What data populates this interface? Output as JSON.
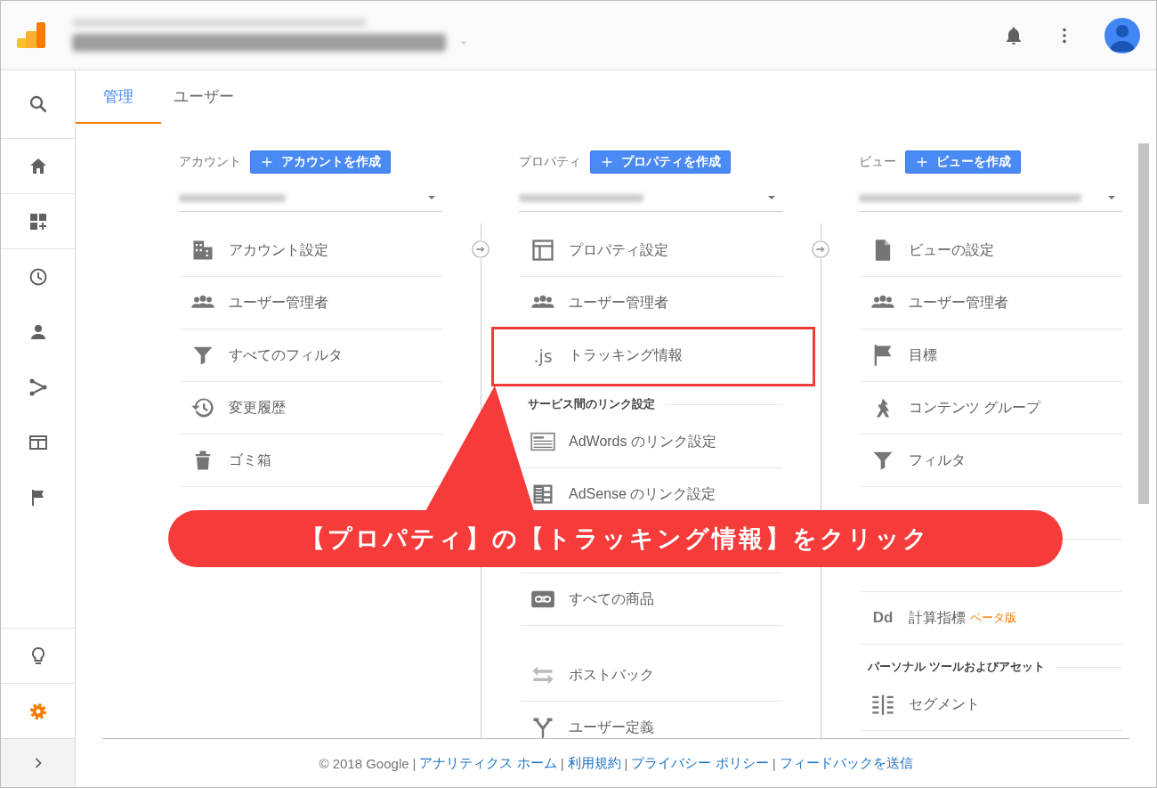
{
  "nav": {
    "items": [
      {
        "selected": false
      },
      {
        "selected": false
      },
      {
        "selected": false
      },
      {
        "selected": false
      },
      {
        "selected": false
      },
      {
        "selected": false
      },
      {
        "selected": false
      },
      {
        "selected": false
      }
    ],
    "bottom": [
      {
        "selected": false
      },
      {
        "selected": true
      }
    ]
  },
  "tabs": [
    {
      "label": "管理",
      "selected": true
    },
    {
      "label": "ユーザー",
      "selected": false
    }
  ],
  "columns": [
    {
      "label": "アカウント",
      "create_button": "アカウントを作成",
      "items": [
        {
          "kind": "item",
          "label": "アカウント設定"
        },
        {
          "kind": "item",
          "label": "ユーザー管理者"
        },
        {
          "kind": "item",
          "label": "すべてのフィルタ"
        },
        {
          "kind": "item",
          "label": "変更履歴"
        },
        {
          "kind": "item",
          "label": "ゴミ箱"
        }
      ]
    },
    {
      "label": "プロパティ",
      "create_button": "プロパティを作成",
      "items": [
        {
          "kind": "item",
          "label": "プロパティ設定"
        },
        {
          "kind": "item",
          "label": "ユーザー管理者"
        },
        {
          "kind": "item",
          "label": "トラッキング情報",
          "icon_text": ".js",
          "highlighted": true
        },
        {
          "kind": "header",
          "label": "サービス間のリンク設定"
        },
        {
          "kind": "item",
          "label": "AdWords のリンク設定"
        },
        {
          "kind": "item",
          "label": "AdSense のリンク設定"
        },
        {
          "kind": "covered"
        },
        {
          "kind": "item",
          "label": "すべての商品"
        },
        {
          "kind": "blank"
        },
        {
          "kind": "item",
          "label": "ポストバック"
        },
        {
          "kind": "item",
          "label": "ユーザー定義"
        }
      ]
    },
    {
      "label": "ビュー",
      "create_button": "ビューを作成",
      "items": [
        {
          "kind": "item",
          "label": "ビューの設定"
        },
        {
          "kind": "item",
          "label": "ユーザー管理者"
        },
        {
          "kind": "item",
          "label": "目標"
        },
        {
          "kind": "item",
          "label": "コンテンツ グループ"
        },
        {
          "kind": "item",
          "label": "フィルタ"
        },
        {
          "kind": "covered"
        },
        {
          "kind": "covered"
        },
        {
          "kind": "item",
          "label": "計算指標",
          "icon_text": "Dd",
          "badge": "ベータ版"
        },
        {
          "kind": "header",
          "label": "パーソナル ツールおよびアセット"
        },
        {
          "kind": "item",
          "label": "セグメント"
        }
      ]
    }
  ],
  "footer": {
    "copyright": "© 2018 Google",
    "separator": "|",
    "links": [
      "アナリティクス ホーム",
      "利用規約",
      "プライバシー ポリシー",
      "フィードバックを送信"
    ]
  },
  "annotation": {
    "text": "【プロパティ】の【トラッキング情報】をクリック"
  }
}
